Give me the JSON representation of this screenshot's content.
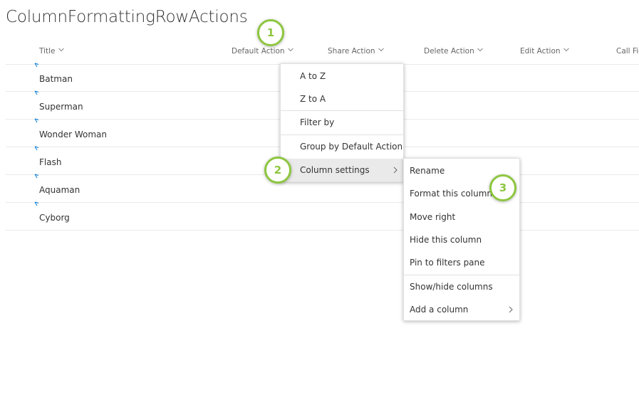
{
  "page": {
    "title": "ColumnFormattingRowActions"
  },
  "columns": [
    {
      "label": "Title"
    },
    {
      "label": "Default Action"
    },
    {
      "label": "Share Action"
    },
    {
      "label": "Delete Action"
    },
    {
      "label": "Edit Action"
    },
    {
      "label": "Call Fic"
    }
  ],
  "rows": [
    {
      "title": "Batman"
    },
    {
      "title": "Superman"
    },
    {
      "title": "Wonder Woman"
    },
    {
      "title": "Flash"
    },
    {
      "title": "Aquaman"
    },
    {
      "title": "Cyborg"
    }
  ],
  "column_menu": {
    "items": [
      {
        "label": "A to Z"
      },
      {
        "label": "Z to A"
      },
      {
        "label": "Filter by"
      },
      {
        "label": "Group by Default Action"
      },
      {
        "label": "Column settings"
      }
    ]
  },
  "column_settings_menu": {
    "items": [
      {
        "label": "Rename"
      },
      {
        "label": "Format this column"
      },
      {
        "label": "Move right"
      },
      {
        "label": "Hide this column"
      },
      {
        "label": "Pin to filters pane"
      },
      {
        "label": "Show/hide columns"
      },
      {
        "label": "Add a column"
      }
    ]
  },
  "callouts": [
    {
      "number": "1"
    },
    {
      "number": "2"
    },
    {
      "number": "3"
    }
  ],
  "colors": {
    "callout_accent": "#8dc63f",
    "new_item_mark": "#0078d4"
  }
}
